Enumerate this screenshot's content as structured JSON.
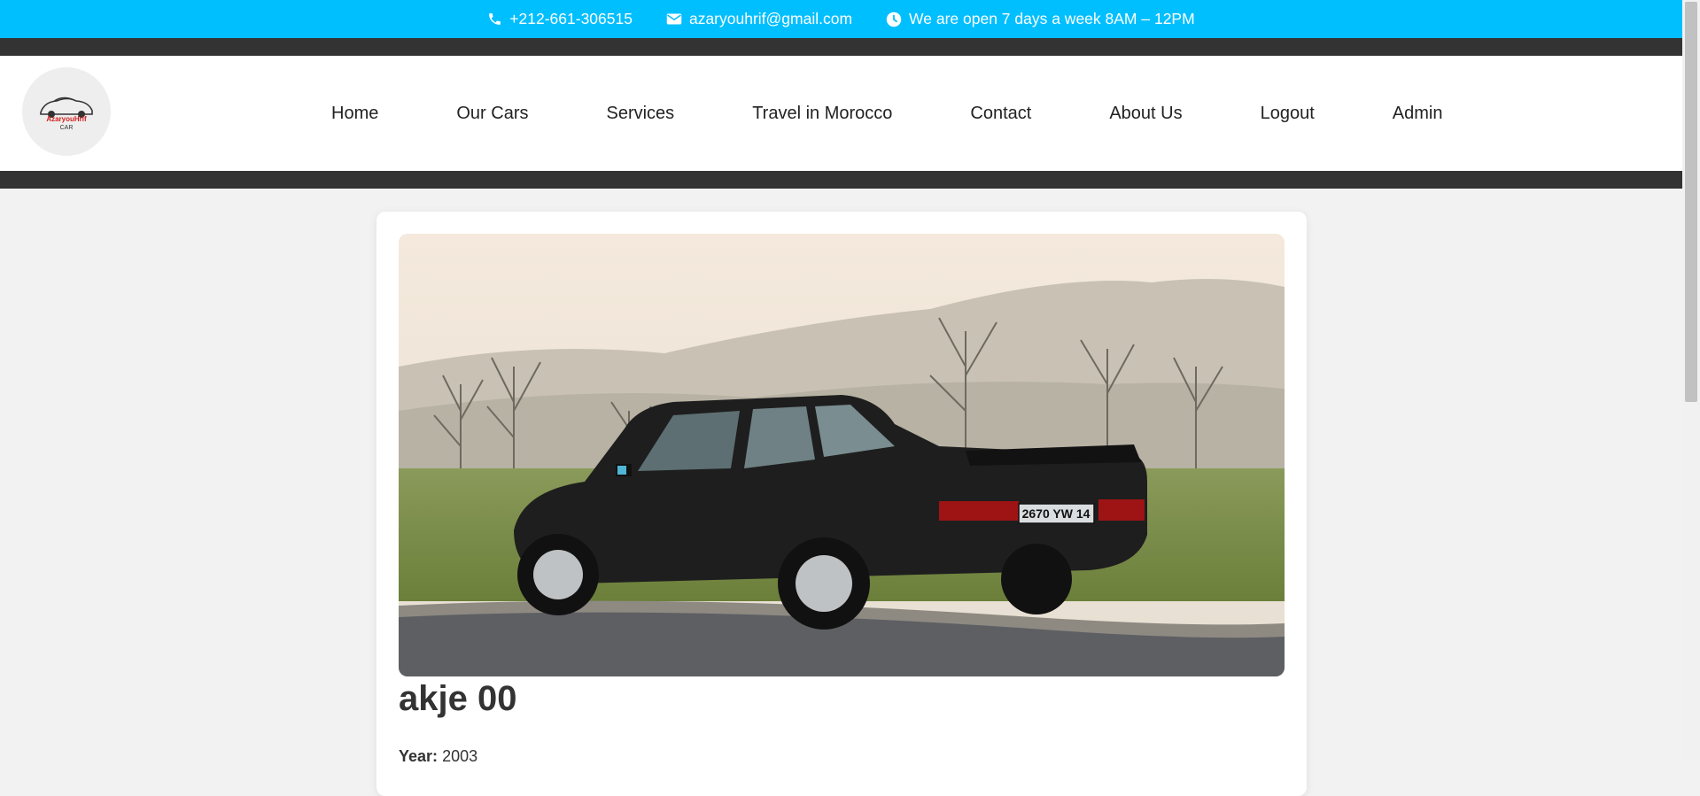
{
  "topbar": {
    "phone": "+212-661-306515",
    "email": "azaryouhrif@gmail.com",
    "hours": "We are open 7 days a week 8AM – 12PM",
    "icons": [
      "phone-icon",
      "envelope-icon",
      "clock-icon"
    ]
  },
  "logo": {
    "line1": "AzaryouHrif",
    "line2": "CAR"
  },
  "nav": {
    "items": [
      "Home",
      "Our Cars",
      "Services",
      "Travel in Morocco",
      "Contact",
      "About Us",
      "Logout",
      "Admin"
    ]
  },
  "car": {
    "name": "akje 00",
    "plate": "2670 YW 14",
    "year_label": "Year:",
    "year_value": "2003"
  },
  "colors": {
    "topbar": "#00bfff",
    "strip": "#333333",
    "page_bg": "#f2f2f2",
    "card_bg": "#ffffff"
  }
}
